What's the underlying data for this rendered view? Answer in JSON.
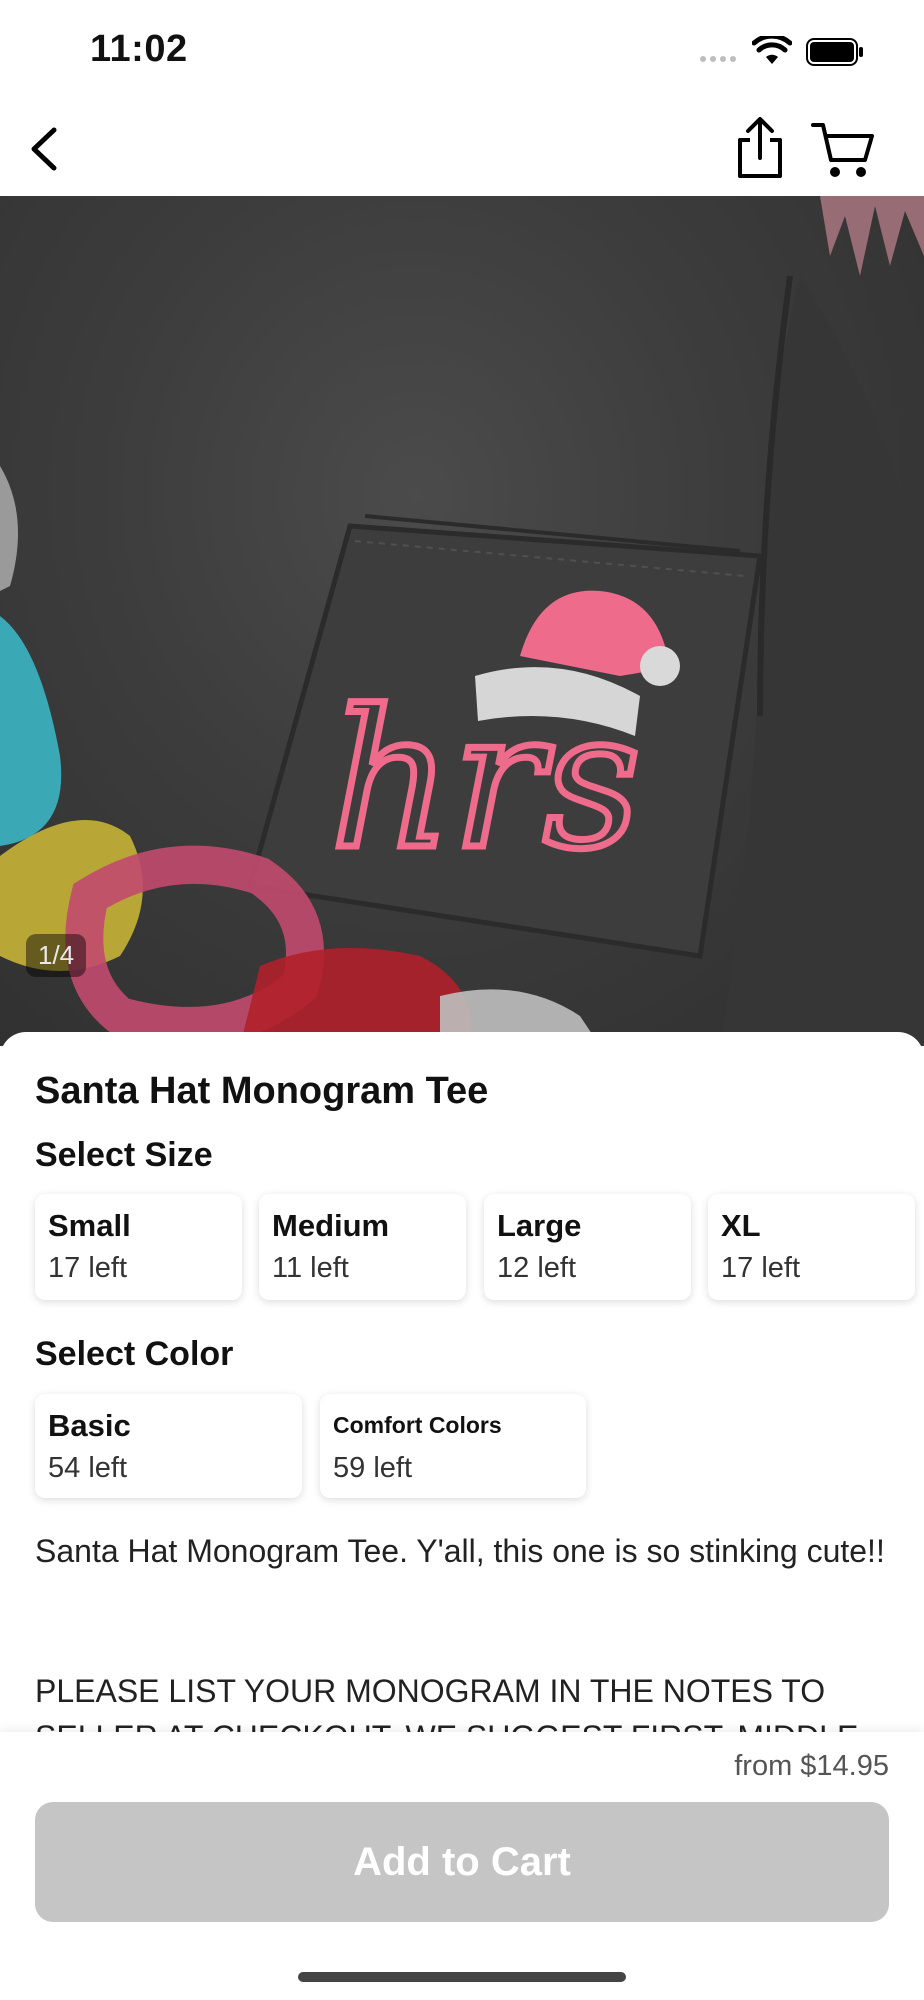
{
  "status_bar": {
    "time": "11:02"
  },
  "nav": {
    "back_icon": "chevron-left-icon",
    "share_icon": "share-icon",
    "cart_icon": "cart-icon"
  },
  "gallery": {
    "counter": "1/4",
    "monogram_text": "hrs"
  },
  "product": {
    "title": "Santa Hat Monogram Tee",
    "size_label": "Select Size",
    "sizes": [
      {
        "name": "Small",
        "stock": "17 left"
      },
      {
        "name": "Medium",
        "stock": "11 left"
      },
      {
        "name": "Large",
        "stock": "12 left"
      },
      {
        "name": "XL",
        "stock": "17 left"
      }
    ],
    "color_label": "Select Color",
    "colors": [
      {
        "name": "Basic",
        "stock": "54 left"
      },
      {
        "name": "Comfort Colors",
        "stock": "59 left"
      }
    ],
    "description_line1": "Santa Hat Monogram Tee. Y'all, this one is so stinking cute!!",
    "description_line2": "PLEASE LIST YOUR MONOGRAM IN THE NOTES TO SELLER AT CHECKOUT. WE SUGGEST FIRST, MIDDLE"
  },
  "footer": {
    "price": "from $14.95",
    "add_to_cart": "Add to Cart"
  },
  "colors_theme": {
    "button_disabled": "#c5c5c5",
    "monogram_pink": "#ee6b8c",
    "shirt_gray": "#3a3a3a"
  }
}
